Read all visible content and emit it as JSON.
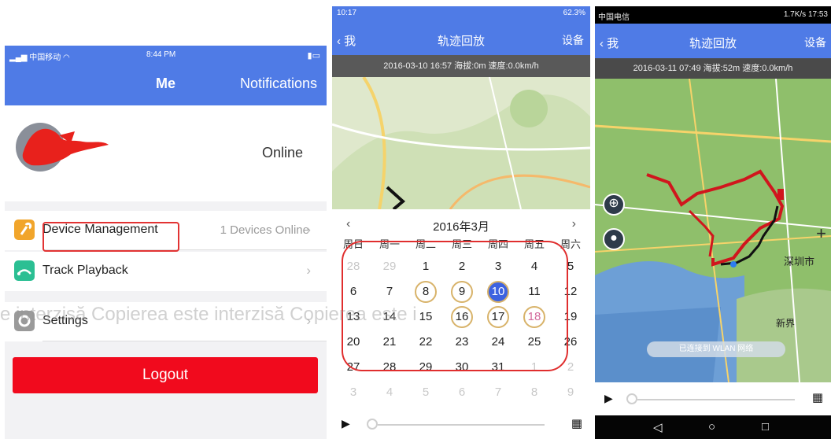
{
  "colors": {
    "accent": "#4f7be6",
    "logout": "#f10a1d",
    "highlight": "#e23333",
    "route": "#d0161d",
    "selected_day": "#3e63e0"
  },
  "panel1": {
    "status": {
      "carrier": "中国移动",
      "time": "8:44 PM"
    },
    "header": {
      "title": "Me",
      "notifications": "Notifications"
    },
    "profile": {
      "status": "Online"
    },
    "menu": [
      {
        "label": "Device Management",
        "value": "1 Devices Online",
        "icon": "wrench-icon"
      },
      {
        "label": "Track Playback",
        "value": "",
        "icon": "track-icon"
      },
      {
        "label": "Settings",
        "value": "",
        "icon": "gear-icon"
      }
    ],
    "logout": "Logout"
  },
  "panel2": {
    "status": {
      "time": "10:17",
      "right": "62.3%"
    },
    "nav": {
      "back": "我",
      "title": "轨迹回放",
      "right": "设备"
    },
    "info": "2016-03-10 16:57  海拔:0m  速度:0.0km/h",
    "calendar": {
      "month": "2016年3月",
      "weekdays": [
        "周日",
        "周一",
        "周二",
        "周三",
        "周四",
        "周五",
        "周六"
      ],
      "weeks": [
        [
          "28",
          "29",
          "1",
          "2",
          "3",
          "4",
          "5"
        ],
        [
          "6",
          "7",
          "8",
          "9",
          "10",
          "11",
          "12"
        ],
        [
          "13",
          "14",
          "15",
          "16",
          "17",
          "18",
          "19"
        ],
        [
          "20",
          "21",
          "22",
          "23",
          "24",
          "25",
          "26"
        ],
        [
          "27",
          "28",
          "29",
          "30",
          "31",
          "1",
          "2"
        ],
        [
          "3",
          "4",
          "5",
          "6",
          "7",
          "8",
          "9"
        ]
      ],
      "dim_cells": [
        "0-0",
        "0-1",
        "4-5",
        "4-6",
        "5-0",
        "5-1",
        "5-2",
        "5-3",
        "5-4",
        "5-5",
        "5-6"
      ],
      "ringed_cells": [
        "1-2",
        "1-3",
        "2-3",
        "2-4",
        "2-5"
      ],
      "selected_cell": "1-4",
      "pink_cells": [
        "2-5"
      ]
    }
  },
  "panel3": {
    "status": {
      "carrier": "中国电信",
      "speed": "1.7K/s",
      "time": "17:53"
    },
    "nav": {
      "back": "我",
      "title": "轨迹回放",
      "right": "设备"
    },
    "info": "2016-03-11 07:49  海拔:52m  速度:0.0km/h",
    "map_labels": {
      "city": "深圳市",
      "district": "新界"
    },
    "toast": "已连接到 WLAN 网络"
  },
  "watermark": "e interzisă Copierea este interzisă Copierea este i"
}
